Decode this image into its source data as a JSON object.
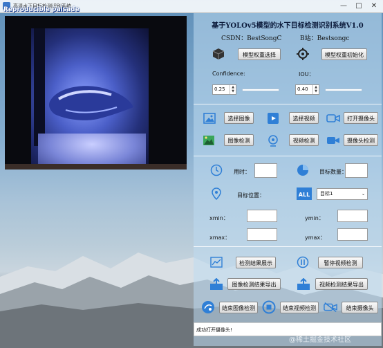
{
  "window": {
    "title": "高清水下目标检测识别系统",
    "overlay_text": "Reproducible palsade"
  },
  "header": {
    "title": "基于YOLOv5模型的水下目标检测识别系统V1.0",
    "csdn": "CSDN：BestSongC",
    "bilibili": "B站：Bestsongc"
  },
  "model": {
    "select_label": "模型权重选择",
    "init_label": "模型权重初始化"
  },
  "params": {
    "confidence_label": "Confidence:",
    "confidence_value": "0.25",
    "iou_label": "IOU：",
    "iou_value": "0.40"
  },
  "actions": {
    "select_image": "选择图像",
    "select_video": "选择视频",
    "open_camera": "打开摄像头",
    "image_detect": "图像检测",
    "video_detect": "视频检测",
    "camera_detect": "摄像头检测"
  },
  "results": {
    "time_label": "用时：",
    "count_label": "目标数量：",
    "position_label": "目标位置：",
    "target_select_value": "目标1",
    "xmin_label": "xmin：",
    "ymin_label": "ymin：",
    "xmax_label": "xmax：",
    "ymax_label": "ymax："
  },
  "bottom": {
    "show_results": "检测结果展示",
    "pause_video": "暂停视频检测",
    "export_image": "图像检测结果导出",
    "export_video": "视频检测结果导出",
    "end_image": "结束图像检测",
    "end_video": "结束视频检测",
    "end_camera": "结束摄像头"
  },
  "status": {
    "text": "成功打开摄像头!"
  },
  "watermark": "@稀土掘金技术社区",
  "colors": {
    "accent_blue": "#2f7fd6",
    "icon_green": "#3aa65a"
  }
}
